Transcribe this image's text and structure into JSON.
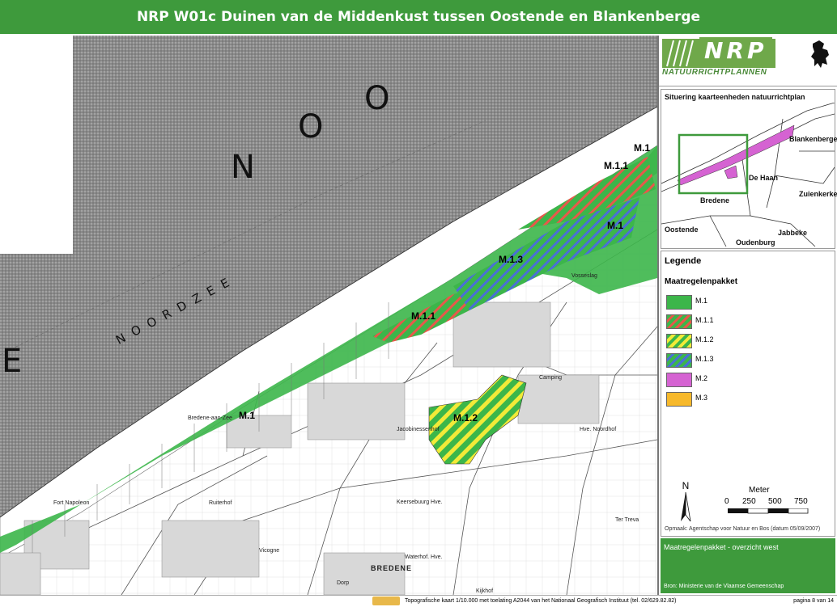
{
  "title": "NRP W01c Duinen van de Middenkust tussen Oostende en Blankenberge",
  "map": {
    "sea_letters": [
      "N",
      "O",
      "O",
      "E"
    ],
    "sea_name": "NOORDZEE",
    "zone_labels": [
      "M.1",
      "M.1.1",
      "M.1",
      "M.1.3",
      "M.1.1",
      "M.1",
      "M.1.2"
    ],
    "places": {
      "bredene_aan_zee": "Bredene-aan-Zee",
      "bredene": "BREDENE",
      "vosseslag": "Vosseslag",
      "jacobinessenhof": "Jacobinessenhof",
      "keerpaalhoek": "Keersebuurg Hve.",
      "ruiterhof": "Ruiterhof",
      "dorp": "Dorp",
      "vicogne": "Vicogne",
      "fort": "Fort Napoleon",
      "camping": "Camping",
      "noordhof": "Hve. Noordhof",
      "ter_treva": "Ter Treva",
      "kijkhof": "Kijkhof",
      "waterhof": "Waterhof. Hve."
    }
  },
  "logo": {
    "brand": "NRP",
    "subtitle": "NATUURRICHTPLANNEN"
  },
  "situering": {
    "title": "Situering kaarteenheden natuurrichtplan",
    "places": [
      "Blankenberge",
      "De Haan",
      "Zuienkerke",
      "Bredene",
      "Oostende",
      "Jabbeke",
      "Oudenburg"
    ]
  },
  "legend": {
    "title": "Legende",
    "subtitle": "Maatregelenpakket",
    "items": [
      {
        "label": "M.1",
        "color": "#3cb64a"
      },
      {
        "label": "M.1.1",
        "color": "#3cb64a",
        "stripe": "#e8584a"
      },
      {
        "label": "M.1.2",
        "color": "#3cb64a",
        "stripe": "#f2ea38"
      },
      {
        "label": "M.1.3",
        "color": "#3cb64a",
        "stripe": "#4a6fd6"
      },
      {
        "label": "M.2",
        "color": "#d563d2"
      },
      {
        "label": "M.3",
        "color": "#f7b92b"
      }
    ]
  },
  "scale": {
    "title": "Meter",
    "ticks": [
      "0",
      "250",
      "500",
      "750"
    ],
    "north": "N"
  },
  "credit": "Opmaak: Agentschap voor Natuur en Bos (datum 05/09/2007)",
  "info": {
    "title": "Maatregelenpakket - overzicht west",
    "source": "Bron: Ministerie van de Vlaamse Gemeenschap"
  },
  "footer": {
    "text": "Topografische kaart 1/10.000 met toelating A2044 van het Nationaal Geografisch Instituut (tel. 02/629.82.82)",
    "page": "pagina 8 van 14"
  },
  "colors": {
    "header": "#3e9a3c",
    "m1": "#3cb64a",
    "m11": "#e8584a",
    "m12": "#f2ea38",
    "m13": "#4a6fd6",
    "m2": "#d563d2",
    "m3": "#f7b92b"
  }
}
